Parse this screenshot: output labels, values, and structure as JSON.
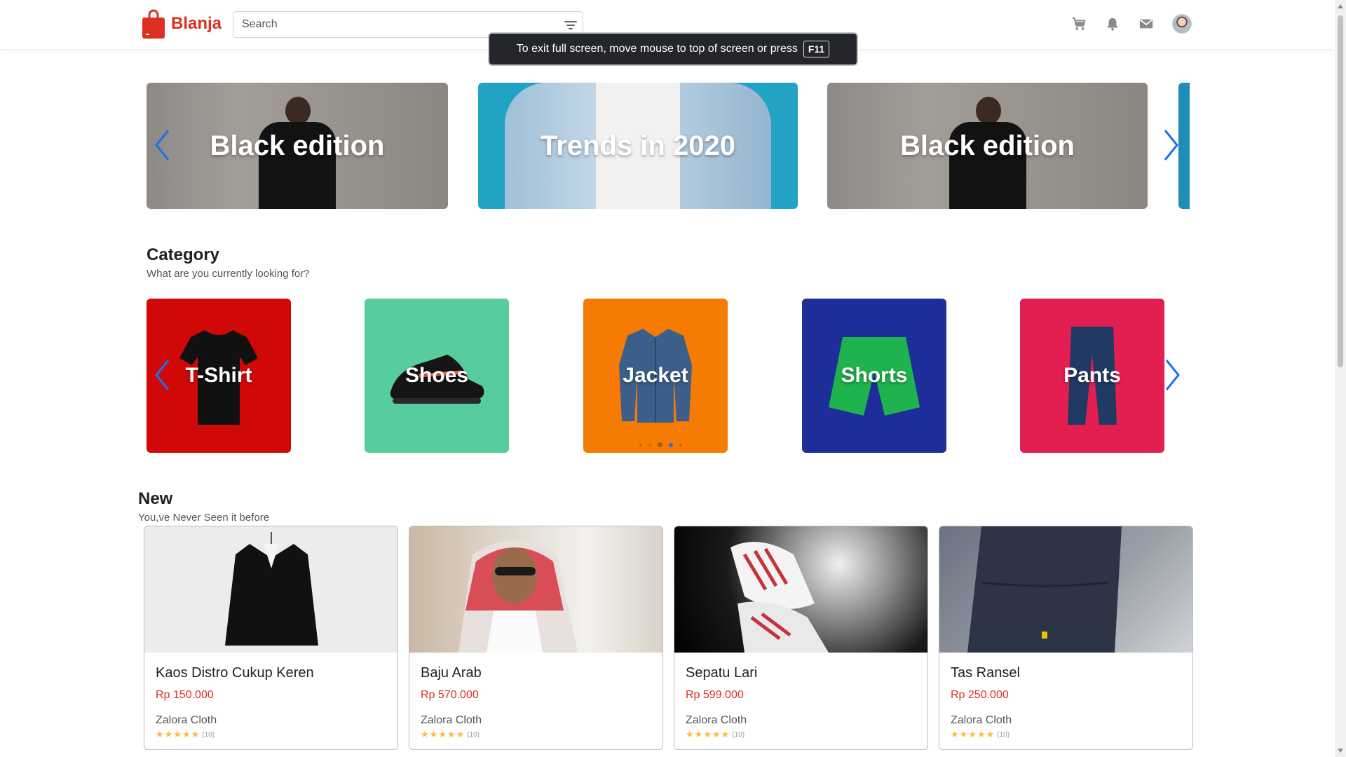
{
  "header": {
    "logo_text": "Blanja",
    "search_placeholder": "Search",
    "icons": [
      "shopping-cart-icon",
      "bell-icon",
      "mail-icon",
      "avatar"
    ]
  },
  "toast": {
    "message": "To exit full screen, move mouse to top of screen or press",
    "key": "F11"
  },
  "banners": [
    {
      "title": "Black edition"
    },
    {
      "title": "Trends in 2020"
    },
    {
      "title": "Black edition"
    }
  ],
  "category": {
    "title": "Category",
    "subtitle": "What are you currently looking for?",
    "items": [
      {
        "label": "T-Shirt",
        "color": "#d00808"
      },
      {
        "label": "Shoes",
        "color": "#57cd9e"
      },
      {
        "label": "Jacket",
        "color": "#f67b02"
      },
      {
        "label": "Shorts",
        "color": "#1d2e9a"
      },
      {
        "label": "Pants",
        "color": "#e31f51"
      }
    ]
  },
  "new_section": {
    "title": "New",
    "subtitle": "You,ve Never Seen it before"
  },
  "products": [
    {
      "name": "Kaos Distro Cukup Keren",
      "price": "Rp 150.000",
      "store": "Zalora Cloth",
      "rating_count": "(10)",
      "stars": 5
    },
    {
      "name": "Baju Arab",
      "price": "Rp 570.000",
      "store": "Zalora Cloth",
      "rating_count": "(10)",
      "stars": 5
    },
    {
      "name": "Sepatu Lari",
      "price": "Rp 599.000",
      "store": "Zalora Cloth",
      "rating_count": "(10)",
      "stars": 5
    },
    {
      "name": "Tas Ransel",
      "price": "Rp 250.000",
      "store": "Zalora Cloth",
      "rating_count": "(10)",
      "stars": 5
    }
  ],
  "colors": {
    "brand": "#db3022",
    "rating_star": "#ffba49",
    "carousel_arrow": "#1a73e8"
  }
}
